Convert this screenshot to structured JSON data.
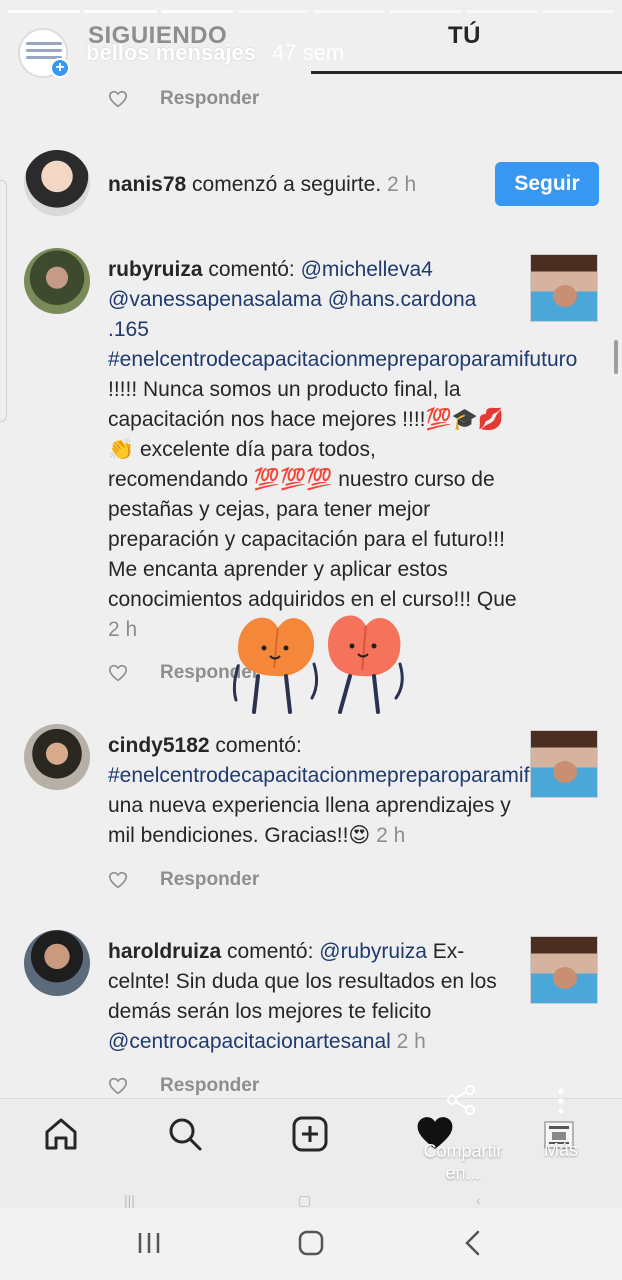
{
  "tabs": {
    "following": "SIGUIENDO",
    "you": "TÚ"
  },
  "story": {
    "username": "bellos mensajes",
    "time": "47 sem",
    "segments_total": 8,
    "segments_done": 3
  },
  "reply_label": "Responder",
  "follow_notification": {
    "username": "nanis78",
    "action": " comenzó a seguirte.",
    "time": " 2 h",
    "button": "Seguir"
  },
  "comments": [
    {
      "username": "rubyruiza",
      "action": " comentó: ",
      "mentions": "@michelleva4 @vanessapenasalama @hans.cardona .165  #enelcentrodecapacitacionmepreparoparamifuturo",
      "body": " !!!!! Nunca somos un producto final, la capacitación nos hace mejores !!!!💯🎓💋👏 excelente día para todos, recomendando 💯💯💯 nuestro curso de pestañas y cejas, para tener mejor preparación y capacitación para el futuro!!! Me encanta aprender y aplicar estos conocimientos adquiridos en el curso!!! Que",
      "time": " 2 h"
    },
    {
      "username": "cindy5182",
      "action": " comentó: ",
      "mentions": "#enelcentrodecapacitacionmepreparoparamifuturo",
      "body": " una nueva experiencia llena aprendizajes y mil bendiciones. Gracias!!😍",
      "time": " 2 h"
    },
    {
      "username": "haroldruiza",
      "action": " comentó: ",
      "mentions": "@rubyruiza",
      "body": " Ex-celnte! Sin duda que los resultados en los demás serán los mejores te felicito ",
      "mentions2": "@centrocapacitacionartesanal",
      "time": " 2 h"
    }
  ],
  "overlay_actions": {
    "share": "Compartir en...",
    "more": "Más"
  },
  "icons": [
    "home-icon",
    "search-icon",
    "add-post-icon",
    "heart-filled-icon",
    "share-icon",
    "more-vertical-icon",
    "heart-outline-icon"
  ],
  "colors": {
    "accent": "#3897f0",
    "link": "#1e3a6e",
    "muted": "#8e8e8e",
    "background": "#efefef"
  }
}
